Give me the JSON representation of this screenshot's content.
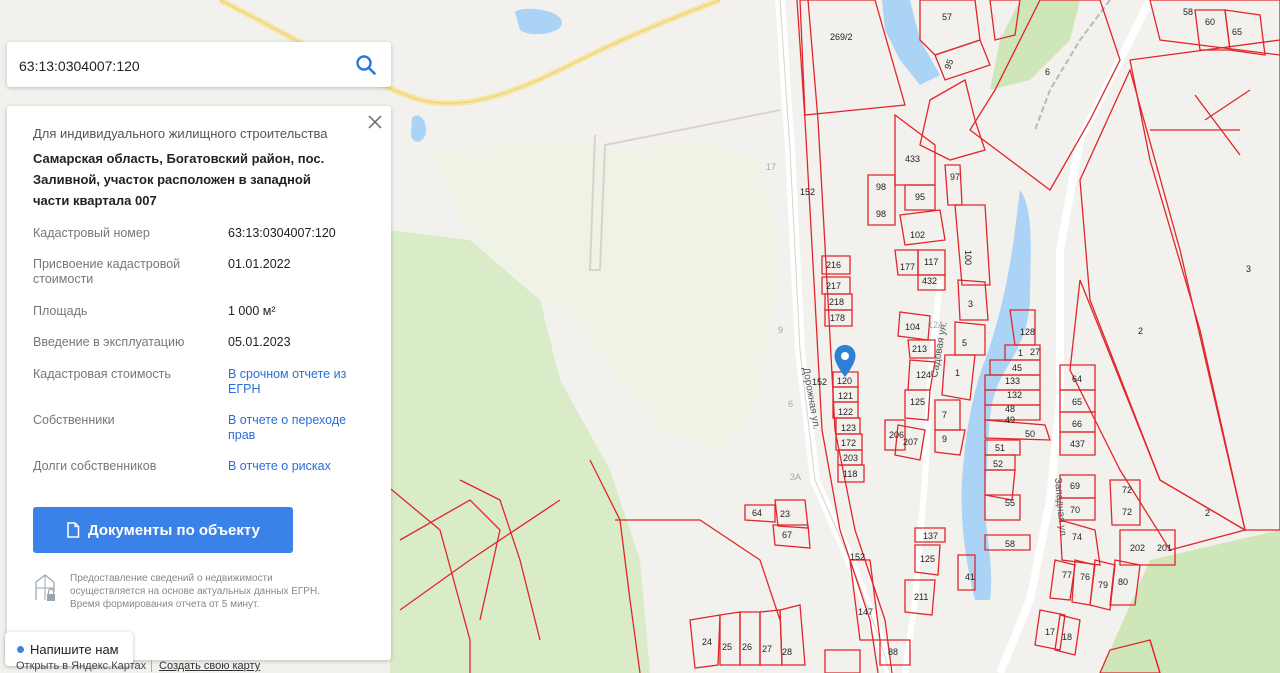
{
  "search": {
    "value": "63:13:0304007:120",
    "icon": "search-icon"
  },
  "card": {
    "purpose": "Для индивидуального жилищного строительства",
    "address": "Самарская область, Богатовский район, пос. Заливной, участок расположен в западной части квартала 007",
    "rows": [
      {
        "label": "Кадастровый номер",
        "value": "63:13:0304007:120"
      },
      {
        "label": "Присвоение кадастровой стоимости",
        "value": "01.01.2022"
      },
      {
        "label": "Площадь",
        "value": "1 000 м²"
      },
      {
        "label": "Введение в эксплуатацию",
        "value": "05.01.2023"
      },
      {
        "label": "Кадастровая стоимость",
        "value": "В срочном отчете из ЕГРН"
      },
      {
        "label": "Собственники",
        "value": "В отчете о переходе прав"
      },
      {
        "label": "Долги собственников",
        "value": "В отчете о рисках"
      }
    ],
    "docs_button": "Документы по объекту",
    "note": "Предоставление сведений о недвижимости осуществляется на основе актуальных данных ЕГРН. Время формирования отчета от 5 минут."
  },
  "chat_button": "Напишите нам",
  "footer": {
    "open_yandex": "Открыть в Яндекс.Картах",
    "create_map": "Создать свою карту"
  },
  "colors": {
    "accent": "#3b82e8",
    "parcel": "#e0262b",
    "water": "#aad3f5",
    "forest": "#d9ecc7"
  },
  "map": {
    "street_labels": [
      "Дорожная ул.",
      "Садовая ул.",
      "Западная ул."
    ],
    "parcel_labels": [
      "57",
      "269/2",
      "95",
      "6",
      "60",
      "65",
      "58",
      "3",
      "433",
      "97",
      "95",
      "98",
      "98",
      "102",
      "100",
      "117",
      "177",
      "432",
      "216",
      "217",
      "218",
      "178",
      "104",
      "213",
      "3",
      "5",
      "1",
      "128",
      "27",
      "45",
      "133",
      "48",
      "49",
      "50",
      "64",
      "65",
      "66",
      "437",
      "69",
      "70",
      "72",
      "72",
      "74",
      "77",
      "78",
      "79",
      "80",
      "202",
      "201",
      "17",
      "18",
      "124",
      "125",
      "1",
      "7",
      "9",
      "206",
      "207",
      "51",
      "52",
      "55",
      "58",
      "120",
      "121",
      "122",
      "123",
      "172",
      "203",
      "118",
      "137",
      "125",
      "211",
      "147",
      "152",
      "152",
      "152",
      "88",
      "24",
      "25",
      "26",
      "27",
      "28",
      "64",
      "23",
      "67",
      "3А",
      "17",
      "9",
      "6",
      "3",
      "2",
      "2",
      "3",
      "12А",
      "41",
      "152"
    ]
  }
}
